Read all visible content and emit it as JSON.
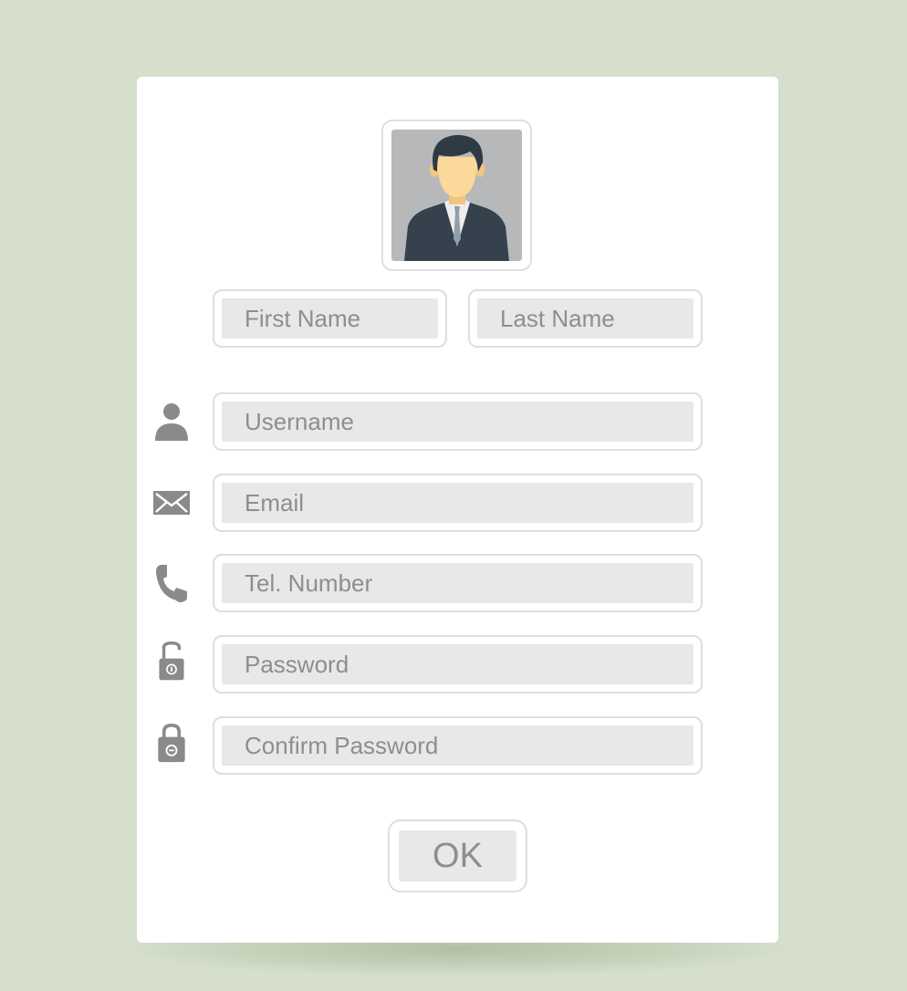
{
  "form": {
    "avatar_icon": "user-avatar-icon",
    "fields": {
      "first_name": {
        "placeholder": "First Name"
      },
      "last_name": {
        "placeholder": "Last Name"
      },
      "username": {
        "placeholder": "Username",
        "icon": "user-icon"
      },
      "email": {
        "placeholder": "Email",
        "icon": "envelope-icon"
      },
      "tel": {
        "placeholder": "Tel. Number",
        "icon": "phone-icon"
      },
      "password": {
        "placeholder": "Password",
        "icon": "unlocked-padlock-icon"
      },
      "confirm_password": {
        "placeholder": "Confirm Password",
        "icon": "locked-padlock-icon"
      }
    },
    "submit_label": "OK"
  },
  "colors": {
    "background": "#d5dfcb",
    "card": "#ffffff",
    "field_fill": "#e8e8e8",
    "field_border": "#dedede",
    "text": "#8e8e8e",
    "icon": "#8a8a8a",
    "avatar_bg": "#b7b8ba",
    "suit": "#35424d",
    "skin": "#fcd89a",
    "hair": "#2e3a44"
  }
}
